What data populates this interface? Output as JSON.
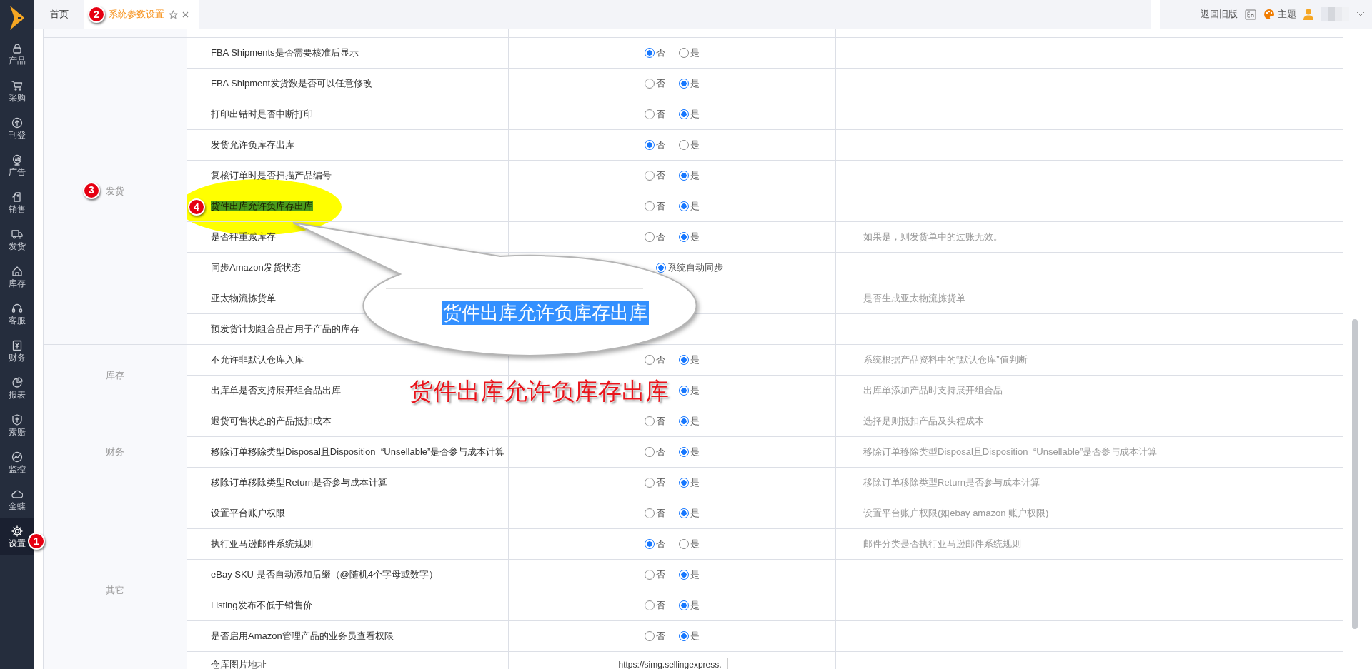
{
  "sidebar": {
    "items": [
      {
        "label": "产品",
        "selected": false
      },
      {
        "label": "采购",
        "selected": false
      },
      {
        "label": "刊登",
        "selected": false
      },
      {
        "label": "广告",
        "selected": false
      },
      {
        "label": "销售",
        "selected": false
      },
      {
        "label": "发货",
        "selected": false
      },
      {
        "label": "库存",
        "selected": false
      },
      {
        "label": "客服",
        "selected": false
      },
      {
        "label": "财务",
        "selected": false
      },
      {
        "label": "报表",
        "selected": false
      },
      {
        "label": "索赔",
        "selected": false
      },
      {
        "label": "监控",
        "selected": false
      },
      {
        "label": "金蝶",
        "selected": false
      },
      {
        "label": "设置",
        "selected": true,
        "marker": "1"
      }
    ]
  },
  "tabs": [
    {
      "label": "首页",
      "selected": false
    },
    {
      "label": "系统参数设置",
      "selected": true,
      "marker": "2",
      "closable": true
    }
  ],
  "header": {
    "back_link": "返回旧版",
    "theme": "主题"
  },
  "settings_table": {
    "groups": [
      {
        "category": "发货",
        "marker": "3",
        "rows": [
          {
            "label": "FBA Shipments是否需要核准后显示",
            "options": [
              {
                "kind": "no",
                "label": "否",
                "selected": true
              },
              {
                "kind": "yes",
                "label": "是",
                "selected": false
              }
            ]
          },
          {
            "label": "FBA Shipment发货数是否可以任意修改",
            "options": [
              {
                "kind": "no",
                "label": "否",
                "selected": false
              },
              {
                "kind": "yes",
                "label": "是",
                "selected": true
              }
            ]
          },
          {
            "label": "打印出错时是否中断打印",
            "options": [
              {
                "kind": "no",
                "label": "否",
                "selected": false
              },
              {
                "kind": "yes",
                "label": "是",
                "selected": true
              }
            ]
          },
          {
            "label": "发货允许负库存出库",
            "options": [
              {
                "kind": "no",
                "label": "否",
                "selected": true
              },
              {
                "kind": "yes",
                "label": "是",
                "selected": false
              }
            ]
          },
          {
            "label": "复核订单时是否扫描产品编号",
            "options": [
              {
                "kind": "no",
                "label": "否",
                "selected": false
              },
              {
                "kind": "yes",
                "label": "是",
                "selected": true
              }
            ]
          },
          {
            "label": "货件出库允许负库存出库",
            "highlighted": true,
            "marker": "4",
            "options": [
              {
                "kind": "no",
                "label": "否",
                "selected": false
              },
              {
                "kind": "yes",
                "label": "是",
                "selected": true
              }
            ]
          },
          {
            "label": "是否秤重减库存",
            "options": [
              {
                "kind": "no",
                "label": "否",
                "selected": false
              },
              {
                "kind": "yes",
                "label": "是",
                "selected": true
              }
            ],
            "description": "如果是，则发货单中的过账无效。"
          },
          {
            "label": "同步Amazon发货状态",
            "options": [
              {
                "kind": "yes",
                "label": "系统自动同步",
                "selected": true
              }
            ]
          },
          {
            "label": "亚太物流拣货单",
            "description": "是否生成亚太物流拣货单"
          },
          {
            "label": "预发货计划组合品占用子产品的库存"
          }
        ]
      },
      {
        "category": "库存",
        "rows": [
          {
            "label": "不允许非默认仓库入库",
            "options": [
              {
                "kind": "no",
                "label": "否",
                "selected": false
              },
              {
                "kind": "yes",
                "label": "是",
                "selected": true
              }
            ],
            "description": "系统根据产品资料中的“默认仓库”值判断"
          },
          {
            "label": "出库单是否支持展开组合品出库",
            "options": [
              {
                "kind": "yes",
                "label": "是",
                "selected": true
              }
            ],
            "description": "出库单添加产品时支持展开组合品"
          }
        ]
      },
      {
        "category": "财务",
        "rows": [
          {
            "label": "退货可售状态的产品抵扣成本",
            "options": [
              {
                "kind": "no",
                "label": "否",
                "selected": false
              },
              {
                "kind": "yes",
                "label": "是",
                "selected": true
              }
            ],
            "description": "选择是则抵扣产品及头程成本"
          },
          {
            "label": "移除订单移除类型Disposal且Disposition=“Unsellable”是否参与成本计算",
            "options": [
              {
                "kind": "no",
                "label": "否",
                "selected": false
              },
              {
                "kind": "yes",
                "label": "是",
                "selected": true
              }
            ],
            "description": "移除订单移除类型Disposal且Disposition=“Unsellable”是否参与成本计算"
          },
          {
            "label": "移除订单移除类型Return是否参与成本计算",
            "options": [
              {
                "kind": "no",
                "label": "否",
                "selected": false
              },
              {
                "kind": "yes",
                "label": "是",
                "selected": true
              }
            ],
            "description": "移除订单移除类型Return是否参与成本计算"
          }
        ]
      },
      {
        "category": "其它",
        "rows": [
          {
            "label": "设置平台账户权限",
            "options": [
              {
                "kind": "no",
                "label": "否",
                "selected": false
              },
              {
                "kind": "yes",
                "label": "是",
                "selected": true
              }
            ],
            "description": "设置平台账户权限(如ebay amazon 账户权限)"
          },
          {
            "label": "执行亚马逊邮件系统规则",
            "options": [
              {
                "kind": "no",
                "label": "否",
                "selected": true
              },
              {
                "kind": "yes",
                "label": "是",
                "selected": false
              }
            ],
            "description": "邮件分类是否执行亚马逊邮件系统规则"
          },
          {
            "label": "eBay SKU 是否自动添加后缀（@随机4个字母或数字）",
            "options": [
              {
                "kind": "no",
                "label": "否",
                "selected": false
              },
              {
                "kind": "yes",
                "label": "是",
                "selected": true
              }
            ]
          },
          {
            "label": "Listing发布不低于销售价",
            "options": [
              {
                "kind": "no",
                "label": "否",
                "selected": false
              },
              {
                "kind": "yes",
                "label": "是",
                "selected": true
              }
            ]
          },
          {
            "label": "是否启用Amazon管理产品的业务员查看权限",
            "options": [
              {
                "kind": "no",
                "label": "否",
                "selected": false
              },
              {
                "kind": "yes",
                "label": "是",
                "selected": true
              }
            ]
          },
          {
            "label": "仓库图片地址",
            "input": {
              "value": "https://simg.sellingexpress."
            }
          }
        ]
      }
    ]
  },
  "callout": {
    "text": "货件出库允许负库存出库",
    "caption": "货件出库允许负库存出库"
  }
}
